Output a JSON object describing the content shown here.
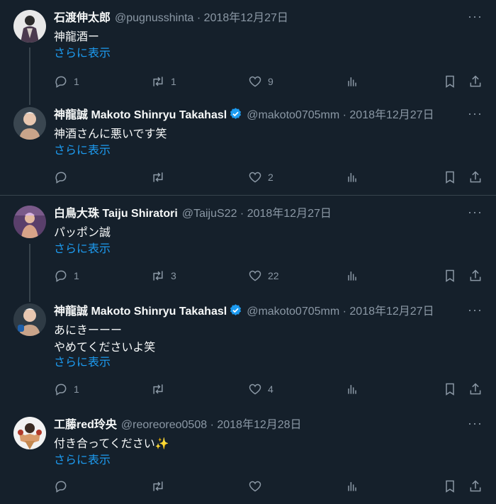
{
  "show_more_label": "さらに表示",
  "more_label": "···",
  "tweets": [
    {
      "name": "石渡伸太郎",
      "handle": "@pugnusshinta",
      "sep": " · ",
      "date": "2018年12月27日",
      "verified": false,
      "text": "神龍酒ー",
      "reply": "1",
      "retweet": "1",
      "like": "9"
    },
    {
      "name": "神龍誠 Makoto Shinryu Takahasl",
      "handle": "@makoto0705mm",
      "sep": " · ",
      "date": "2018年12月27日",
      "verified": true,
      "text": "神酒さんに悪いです笑",
      "reply": "",
      "retweet": "",
      "like": "2"
    },
    {
      "name": "白鳥大珠 Taiju Shiratori",
      "handle": "@TaijuS22",
      "sep": " · ",
      "date": "2018年12月27日",
      "verified": false,
      "text": "パッポン誠",
      "reply": "1",
      "retweet": "3",
      "like": "22"
    },
    {
      "name": "神龍誠 Makoto Shinryu Takahasl",
      "handle": "@makoto0705mm",
      "sep": " · ",
      "date": "2018年12月27日",
      "verified": true,
      "text": "あにきーーー\nやめてくださいよ笑",
      "reply": "1",
      "retweet": "",
      "like": "4"
    },
    {
      "name": "工藤red玲央",
      "handle": "@reoreoreo0508",
      "sep": " · ",
      "date": "2018年12月28日",
      "verified": false,
      "text": "付き合ってください✨",
      "reply": "",
      "retweet": "",
      "like": ""
    }
  ],
  "colors": {
    "background": "#15202b",
    "accent": "#1d9bf0",
    "muted": "#8b98a5",
    "border": "#38444d"
  }
}
